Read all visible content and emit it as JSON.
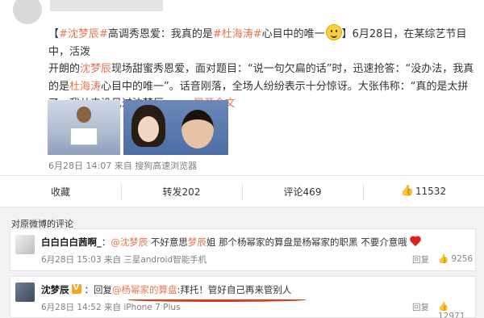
{
  "post": {
    "text_line1_a": "【",
    "hashtag1": "#沈梦辰#",
    "text_line1_b": "高调秀恩爱：我真的是",
    "hashtag2": "#杜海涛#",
    "text_line1_c": "心目中的唯一",
    "text_line1_d": "】6月28日，在某综艺节目中，活泼",
    "text_line2_a": "开朗的",
    "mention1": "沈梦辰",
    "text_line2_b": "现场甜蜜秀恩爱，面对题目：“说一句欠扁的话”时，迅速抢答：“没办法，我真的是",
    "mention2": "杜海涛",
    "text_line3_b": "心目中的唯一”。话音刚落，全场人纷纷表示十分惊讶。大张伟称：“真的是太拼了，我从来没见过沈梦辰……",
    "more": "展开全文",
    "source": "6月28日 14:07 来自 搜狗高速浏览器"
  },
  "actions": {
    "favorite": "收藏",
    "repost": "转发202",
    "comment": "评论469",
    "like": "11532"
  },
  "comments": {
    "title": "对原微博的评论",
    "items": [
      {
        "user": "白白白白茜啊_",
        "sep": "：",
        "mention": "@沈梦辰",
        "text_a": "不好意思",
        "hl": "梦辰",
        "text_b": "姐 那个杨幂家的算盘是杨幂家的职黑 不要介意哦",
        "meta": "6月28日 15:03 来自 三星android智能手机",
        "reply": "回复",
        "likes": "9256"
      },
      {
        "user": "沈梦辰",
        "sep": "：",
        "prefix": "回复",
        "mention": "@杨幂家的算盘",
        "text_a": ":拜托！管好自己再来管别人",
        "meta": "6月28日 14:52 来自 iPhone 7 Plus",
        "reply": "回复",
        "likes": "12971"
      }
    ]
  },
  "colors": {
    "accent": "#eb7350",
    "underline": "#e03a1a"
  }
}
